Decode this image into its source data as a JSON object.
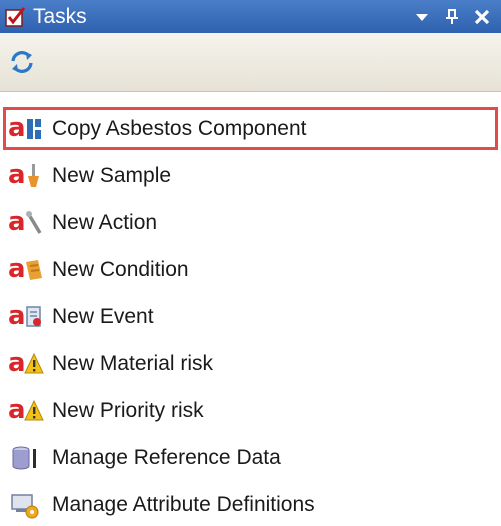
{
  "window": {
    "title": "Tasks",
    "controls": [
      {
        "name": "dropdown-icon"
      },
      {
        "name": "pin-icon"
      },
      {
        "name": "close-icon"
      }
    ]
  },
  "toolbar": {
    "refresh_icon": "refresh-icon"
  },
  "tasks": [
    {
      "label": "Copy Asbestos Component",
      "icon": "copy-component-icon",
      "selected": true
    },
    {
      "label": "New Sample",
      "icon": "sample-icon"
    },
    {
      "label": "New Action",
      "icon": "action-icon"
    },
    {
      "label": "New Condition",
      "icon": "condition-icon"
    },
    {
      "label": "New Event",
      "icon": "event-icon"
    },
    {
      "label": "New Material risk",
      "icon": "material-risk-icon"
    },
    {
      "label": "New Priority risk",
      "icon": "priority-risk-icon"
    },
    {
      "label": "Manage Reference Data",
      "icon": "database-icon"
    },
    {
      "label": "Manage Attribute Definitions",
      "icon": "attribute-definitions-icon"
    }
  ],
  "colors": {
    "titlebar": "#3a6fbd",
    "selection_border": "#e24b4b",
    "asbestos_red": "#d9262b"
  }
}
